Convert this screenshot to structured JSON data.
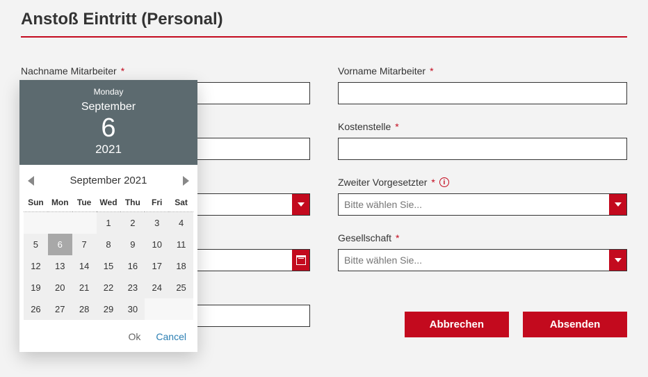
{
  "title": "Anstoß Eintritt (Personal)",
  "labels": {
    "nachname": "Nachname Mitarbeiter",
    "vorname": "Vorname Mitarbeiter",
    "kostenstelle": "Kostenstelle",
    "zweiter": "Zweiter Vorgesetzter",
    "gesellschaft": "Gesellschaft"
  },
  "placeholders": {
    "bitte_wahlen": "Bitte wählen Sie..."
  },
  "buttons": {
    "cancel": "Abbrechen",
    "submit": "Absenden"
  },
  "datepicker": {
    "dow": "Monday",
    "month_label": "September",
    "day": "6",
    "year": "2021",
    "nav_label": "September   2021",
    "headers": [
      "Sun",
      "Mon",
      "Tue",
      "Wed",
      "Thu",
      "Fri",
      "Sat"
    ],
    "weeks": [
      [
        "",
        "",
        "",
        "1",
        "2",
        "3",
        "4"
      ],
      [
        "5",
        "6",
        "7",
        "8",
        "9",
        "10",
        "11"
      ],
      [
        "12",
        "13",
        "14",
        "15",
        "16",
        "17",
        "18"
      ],
      [
        "19",
        "20",
        "21",
        "22",
        "23",
        "24",
        "25"
      ],
      [
        "26",
        "27",
        "28",
        "29",
        "30",
        "",
        ""
      ]
    ],
    "ok": "Ok",
    "cancel": "Cancel"
  }
}
